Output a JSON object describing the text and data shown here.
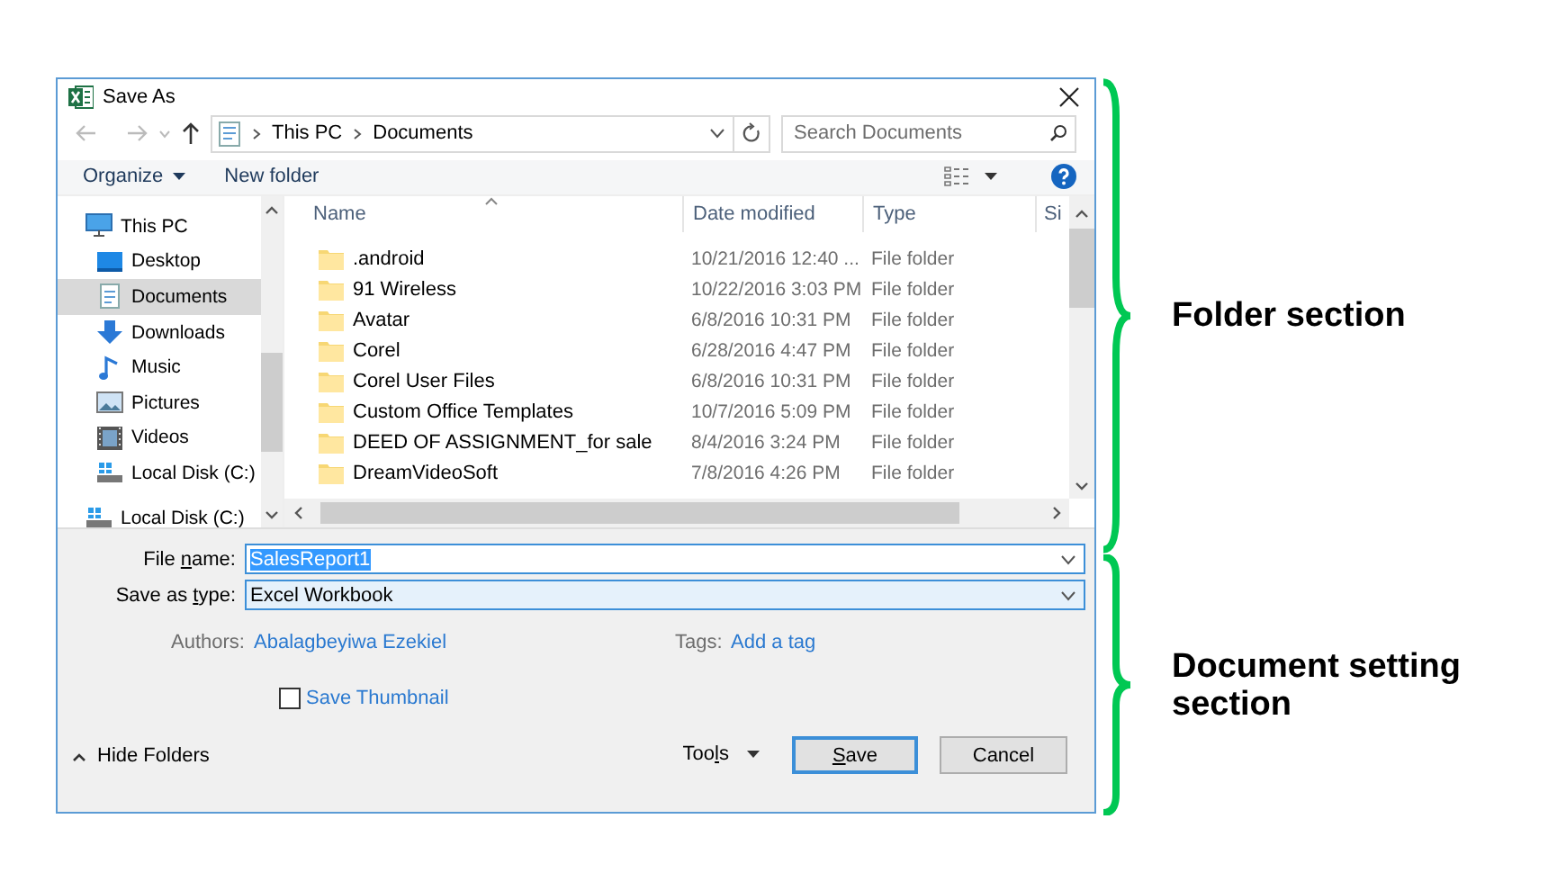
{
  "window": {
    "title": "Save As"
  },
  "address": {
    "crumbs": [
      "This PC",
      "Documents"
    ]
  },
  "search": {
    "placeholder": "Search Documents"
  },
  "toolbar": {
    "organize": "Organize",
    "new_folder": "New folder"
  },
  "nav_items": [
    {
      "label": "This PC",
      "kind": "pc",
      "selected": false,
      "children": [
        {
          "label": "Desktop",
          "kind": "desktop",
          "selected": false
        },
        {
          "label": "Documents",
          "kind": "documents",
          "selected": true
        },
        {
          "label": "Downloads",
          "kind": "downloads",
          "selected": false
        },
        {
          "label": "Music",
          "kind": "music",
          "selected": false
        },
        {
          "label": "Pictures",
          "kind": "pictures",
          "selected": false
        },
        {
          "label": "Videos",
          "kind": "videos",
          "selected": false
        },
        {
          "label": "Local Disk (C:)",
          "kind": "disk",
          "selected": false
        }
      ]
    },
    {
      "label": "Local Disk (C:)",
      "kind": "disk",
      "selected": false
    }
  ],
  "columns": [
    {
      "label": "Name",
      "sorted": true
    },
    {
      "label": "Date modified",
      "sorted": false
    },
    {
      "label": "Type",
      "sorted": false
    },
    {
      "label": "Si",
      "sorted": false
    }
  ],
  "rows": [
    {
      "name": ".android",
      "date": "10/21/2016 12:40 ...",
      "type": "File folder"
    },
    {
      "name": "91 Wireless",
      "date": "10/22/2016 3:03 PM",
      "type": "File folder"
    },
    {
      "name": "Avatar",
      "date": "6/8/2016 10:31 PM",
      "type": "File folder"
    },
    {
      "name": "Corel",
      "date": "6/28/2016 4:47 PM",
      "type": "File folder"
    },
    {
      "name": "Corel User Files",
      "date": "6/8/2016 10:31 PM",
      "type": "File folder"
    },
    {
      "name": "Custom Office Templates",
      "date": "10/7/2016 5:09 PM",
      "type": "File folder"
    },
    {
      "name": "DEED OF ASSIGNMENT_for sale",
      "date": "8/4/2016 3:24 PM",
      "type": "File folder"
    },
    {
      "name": "DreamVideoSoft",
      "date": "7/8/2016 4:26 PM",
      "type": "File folder"
    }
  ],
  "form": {
    "file_name": {
      "label_before": "File ",
      "label_key": "n",
      "label_after": "ame:",
      "value": "SalesReport1",
      "text_selected": true
    },
    "save_as_type": {
      "label_before": "Save as ",
      "label_key": "t",
      "label_after": "ype:",
      "value": "Excel Workbook"
    },
    "authors": {
      "label": "Authors:",
      "value": "Abalagbeyiwa Ezekiel"
    },
    "tags": {
      "label": "Tags:",
      "value": "Add a tag"
    },
    "save_thumbnail": {
      "label": "Save Thumbnail",
      "checked": false
    }
  },
  "footer": {
    "hide_folders": "Hide Folders",
    "tools": {
      "label_before": "Too",
      "label_key": "l",
      "label_after": "s"
    },
    "buttons": [
      {
        "label_key": "S",
        "label_after": "ave",
        "default": true
      },
      {
        "label_after": "Cancel",
        "default": false
      }
    ]
  },
  "annotations": [
    {
      "label": "Folder section"
    },
    {
      "label": "Document setting section"
    }
  ]
}
